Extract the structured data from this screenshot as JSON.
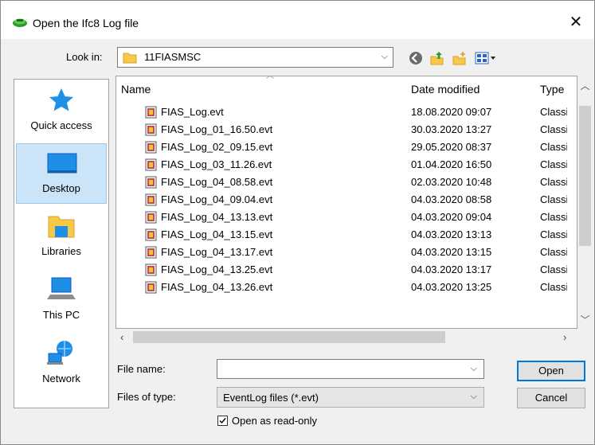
{
  "window": {
    "title": "Open the Ifc8 Log file",
    "close_glyph": "✕"
  },
  "lookin": {
    "label": "Look in:",
    "value": "11FIASMSC"
  },
  "places": [
    {
      "label": "Quick access",
      "icon": "star-icon"
    },
    {
      "label": "Desktop",
      "icon": "desktop-icon",
      "selected": true
    },
    {
      "label": "Libraries",
      "icon": "libraries-icon"
    },
    {
      "label": "This PC",
      "icon": "computer-icon"
    },
    {
      "label": "Network",
      "icon": "network-icon"
    }
  ],
  "columns": {
    "name": "Name",
    "date": "Date modified",
    "type": "Type"
  },
  "files": [
    {
      "name": "FIAS_Log.evt",
      "date": "18.08.2020 09:07",
      "type": "Classic"
    },
    {
      "name": "FIAS_Log_01_16.50.evt",
      "date": "30.03.2020 13:27",
      "type": "Classic"
    },
    {
      "name": "FIAS_Log_02_09.15.evt",
      "date": "29.05.2020 08:37",
      "type": "Classic"
    },
    {
      "name": "FIAS_Log_03_11.26.evt",
      "date": "01.04.2020 16:50",
      "type": "Classic"
    },
    {
      "name": "FIAS_Log_04_08.58.evt",
      "date": "02.03.2020 10:48",
      "type": "Classic"
    },
    {
      "name": "FIAS_Log_04_09.04.evt",
      "date": "04.03.2020 08:58",
      "type": "Classic"
    },
    {
      "name": "FIAS_Log_04_13.13.evt",
      "date": "04.03.2020 09:04",
      "type": "Classic"
    },
    {
      "name": "FIAS_Log_04_13.15.evt",
      "date": "04.03.2020 13:13",
      "type": "Classic"
    },
    {
      "name": "FIAS_Log_04_13.17.evt",
      "date": "04.03.2020 13:15",
      "type": "Classic"
    },
    {
      "name": "FIAS_Log_04_13.25.evt",
      "date": "04.03.2020 13:17",
      "type": "Classic"
    },
    {
      "name": "FIAS_Log_04_13.26.evt",
      "date": "04.03.2020 13:25",
      "type": "Classic"
    }
  ],
  "form": {
    "filename_label": "File name:",
    "filename_value": "",
    "filetype_label": "Files of type:",
    "filetype_value": "EventLog files (*.evt)",
    "readonly_label": "Open as read-only",
    "readonly_checked": true
  },
  "buttons": {
    "open": "Open",
    "cancel": "Cancel"
  },
  "colors": {
    "accent": "#0078d7",
    "selection": "#cce4f7",
    "folder": "#f8c848"
  }
}
